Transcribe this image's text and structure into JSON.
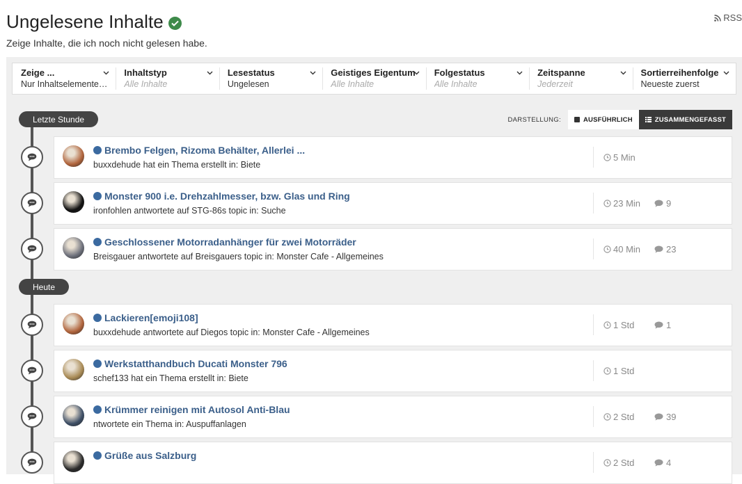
{
  "header": {
    "title": "Ungelesene Inhalte",
    "subtitle": "Zeige Inhalte, die ich noch nicht gelesen habe.",
    "rss_label": "RSS"
  },
  "filters": [
    {
      "label": "Zeige ...",
      "value": "Nur Inhaltselemente…",
      "placeholder": false
    },
    {
      "label": "Inhaltstyp",
      "value": "Alle Inhalte",
      "placeholder": true
    },
    {
      "label": "Lesestatus",
      "value": "Ungelesen",
      "placeholder": false
    },
    {
      "label": "Geistiges Eigentum",
      "value": "Alle Inhalte",
      "placeholder": true
    },
    {
      "label": "Folgestatus",
      "value": "Alle Inhalte",
      "placeholder": true
    },
    {
      "label": "Zeitspanne",
      "value": "Jederzeit",
      "placeholder": true
    },
    {
      "label": "Sortierreihenfolge",
      "value": "Neueste zuerst",
      "placeholder": false
    }
  ],
  "view": {
    "label": "DARSTELLUNG:",
    "expanded": "AUSFÜHRLICH",
    "condensed": "ZUSAMMENGEFASST"
  },
  "groups": [
    {
      "label": "Letzte Stunde",
      "items": [
        {
          "title": "Brembo Felgen, Rizoma Behälter, Allerlei ...",
          "sub": "buxxdehude hat ein Thema erstellt in: Biete",
          "time": "5 Min",
          "replies": "",
          "avatar_color": "#b0643c"
        },
        {
          "title": "Monster 900 i.e. Drehzahlmesser, bzw. Glas und Ring",
          "sub": "ironfohlen antwortete auf STG-86s topic in: Suche",
          "time": "23 Min",
          "replies": "9",
          "avatar_color": "#111111"
        },
        {
          "title": "Geschlossener Motorradanhänger für zwei Motorräder",
          "sub": "Breisgauer antwortete auf Breisgauers topic in: Monster Cafe - Allgemeines",
          "time": "40 Min",
          "replies": "23",
          "avatar_color": "#6c6f7a"
        }
      ]
    },
    {
      "label": "Heute",
      "items": [
        {
          "title": "Lackieren[emoji108]",
          "sub": "buxxdehude antwortete auf Diegos topic in: Monster Cafe - Allgemeines",
          "time": "1 Std",
          "replies": "1",
          "avatar_color": "#b0643c"
        },
        {
          "title": "Werkstatthandbuch Ducati Monster 796",
          "sub": "schef133 hat ein Thema erstellt in: Biete",
          "time": "1 Std",
          "replies": "",
          "avatar_color": "#a88a55"
        },
        {
          "title": "Krümmer reinigen mit Autosol Anti-Blau",
          "sub": "ntwortete ein Thema in: Auspuffanlagen",
          "time": "2 Std",
          "replies": "39",
          "avatar_color": "#3e4f66"
        },
        {
          "title": "Grüße aus Salzburg",
          "sub": "",
          "time": "2 Std",
          "replies": "4",
          "avatar_color": "#2a2a2a"
        }
      ]
    }
  ],
  "colors": {
    "accent": "#3b5f8a",
    "dot": "#3b6aa0",
    "verified": "#3e8a4a",
    "timeline": "#555555"
  }
}
